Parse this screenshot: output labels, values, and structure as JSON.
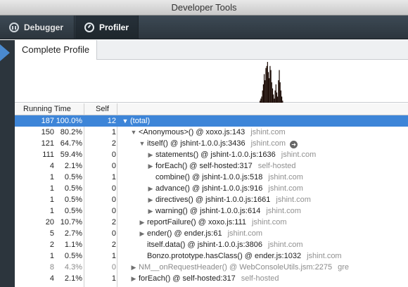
{
  "window": {
    "title": "Developer Tools"
  },
  "tabs": [
    {
      "label": "Debugger",
      "active": false
    },
    {
      "label": "Profiler",
      "active": true
    }
  ],
  "profile": {
    "tab_label": "Complete Profile"
  },
  "columns": {
    "running_time": "Running Time",
    "self": "Self"
  },
  "colors": {
    "selected_row": "#3d85d8",
    "toolbar": "#2f3a43"
  },
  "graph_values": [
    0,
    0,
    0,
    0,
    0,
    0,
    0,
    0,
    0,
    0,
    0,
    0,
    0,
    0,
    0,
    0,
    0,
    0,
    0,
    0,
    0,
    0,
    0,
    0,
    0,
    0,
    0,
    0,
    0,
    0,
    0,
    0,
    0,
    0,
    0,
    0,
    0,
    0,
    0,
    0,
    0,
    0,
    0,
    0,
    0,
    0,
    0,
    0,
    0,
    0,
    0,
    0,
    0,
    0,
    0,
    0,
    0,
    0,
    0,
    0,
    0,
    0,
    0,
    0,
    0,
    0,
    0,
    0,
    0,
    0,
    0,
    0,
    0,
    0,
    0,
    0,
    0,
    0,
    0,
    0,
    0,
    0,
    0,
    0,
    0,
    0,
    0,
    0,
    0,
    0,
    0,
    0,
    0,
    0,
    0,
    0,
    0,
    0,
    0,
    0,
    0,
    0,
    0,
    0,
    0,
    0,
    0,
    0,
    0,
    0,
    0,
    0,
    0,
    0,
    0,
    0,
    0,
    0,
    0,
    0,
    0,
    0,
    0,
    0,
    0,
    0,
    0,
    0,
    0,
    0,
    0,
    0,
    0,
    0,
    0,
    0,
    0,
    0,
    0,
    0,
    0,
    0,
    0,
    0,
    0,
    0,
    0,
    0,
    0,
    0,
    0,
    0,
    0,
    0,
    0,
    0,
    0,
    0,
    0,
    0,
    0,
    0,
    0,
    0,
    0,
    0,
    0,
    0,
    0,
    0,
    0,
    0,
    0,
    0,
    0,
    0,
    0,
    0,
    0,
    0,
    0,
    0,
    0,
    0,
    0,
    0,
    0,
    0,
    0,
    0,
    0,
    0,
    0,
    0,
    0,
    0,
    0,
    0,
    0,
    0,
    0,
    0,
    0,
    0,
    0,
    0,
    0,
    0,
    0,
    0,
    0,
    0,
    0,
    0,
    0,
    0,
    0,
    0,
    0,
    0,
    0,
    0,
    0,
    0,
    0,
    0,
    0,
    0,
    0,
    0,
    0,
    0,
    0,
    0,
    0,
    0,
    0,
    0,
    0,
    0,
    0,
    0,
    0,
    0,
    0,
    0,
    0,
    0,
    0,
    0,
    0,
    0,
    0,
    0,
    0,
    0,
    0,
    0,
    0,
    0,
    0,
    0,
    0,
    0,
    0,
    0,
    0,
    0,
    0,
    0,
    0,
    0,
    0,
    0,
    0,
    0,
    0,
    0,
    0,
    0,
    0,
    0,
    0,
    0,
    0,
    0,
    0,
    0,
    0,
    0,
    0,
    0,
    0.05,
    0.1,
    0.15,
    0.3,
    0.45,
    0.7,
    0.55,
    0.85,
    0.9,
    1,
    0.75,
    0.6,
    0.9,
    0.8,
    0.5,
    0.35,
    0.2,
    0.1,
    0.3,
    0.45,
    0.25,
    0.15,
    0.55,
    0.8,
    0.5,
    0.3,
    0.15,
    0.05,
    0,
    0,
    0,
    0,
    0,
    0,
    0,
    0,
    0,
    0,
    0,
    0,
    0,
    0,
    0,
    0,
    0,
    0,
    0,
    0,
    0,
    0,
    0,
    0,
    0,
    0,
    0,
    0,
    0,
    0,
    0,
    0,
    0,
    0,
    0,
    0,
    0,
    0,
    0,
    0,
    0,
    0,
    0,
    0,
    0,
    0,
    0,
    0,
    0,
    0,
    0,
    0,
    0,
    0,
    0,
    0,
    0,
    0,
    0,
    0,
    0,
    0,
    0,
    0,
    0,
    0,
    0,
    0,
    0,
    0,
    0,
    0,
    0,
    0,
    0,
    0,
    0,
    0,
    0,
    0,
    0,
    0,
    0,
    0,
    0,
    0,
    0,
    0,
    0,
    0,
    0,
    0,
    0,
    0,
    0,
    0,
    0,
    0,
    0,
    0,
    0,
    0,
    0,
    0,
    0,
    0,
    0,
    0,
    0,
    0,
    0,
    0,
    0,
    0,
    0,
    0,
    0,
    0,
    0,
    0,
    0,
    0,
    0,
    0,
    0,
    0,
    0,
    0,
    0,
    0,
    0,
    0,
    0,
    0,
    0,
    0,
    0,
    0,
    0,
    0,
    0,
    0,
    0,
    0,
    0,
    0,
    0,
    0,
    0
  ],
  "rows": [
    {
      "ms": "187",
      "pct": "100.0%",
      "self": "12",
      "depth": 0,
      "twisty": "open",
      "fn": "(total)",
      "host": "",
      "go": false,
      "selected": true
    },
    {
      "ms": "150",
      "pct": "80.2%",
      "self": "1",
      "depth": 1,
      "twisty": "open",
      "fn": "<Anonymous>() @ xoxo.js:143",
      "host": "jshint.com",
      "go": false
    },
    {
      "ms": "121",
      "pct": "64.7%",
      "self": "2",
      "depth": 2,
      "twisty": "open",
      "fn": "itself() @ jshint-1.0.0.js:3436",
      "host": "jshint.com",
      "go": true
    },
    {
      "ms": "111",
      "pct": "59.4%",
      "self": "0",
      "depth": 3,
      "twisty": "closed",
      "fn": "statements() @ jshint-1.0.0.js:1636",
      "host": "jshint.com",
      "go": false
    },
    {
      "ms": "4",
      "pct": "2.1%",
      "self": "0",
      "depth": 3,
      "twisty": "closed",
      "fn": "forEach() @ self-hosted:317",
      "host": "self-hosted",
      "go": false
    },
    {
      "ms": "1",
      "pct": "0.5%",
      "self": "1",
      "depth": 3,
      "twisty": "none",
      "fn": "combine() @ jshint-1.0.0.js:518",
      "host": "jshint.com",
      "go": false
    },
    {
      "ms": "1",
      "pct": "0.5%",
      "self": "0",
      "depth": 3,
      "twisty": "closed",
      "fn": "advance() @ jshint-1.0.0.js:916",
      "host": "jshint.com",
      "go": false
    },
    {
      "ms": "1",
      "pct": "0.5%",
      "self": "0",
      "depth": 3,
      "twisty": "closed",
      "fn": "directives() @ jshint-1.0.0.js:1661",
      "host": "jshint.com",
      "go": false
    },
    {
      "ms": "1",
      "pct": "0.5%",
      "self": "0",
      "depth": 3,
      "twisty": "closed",
      "fn": "warning() @ jshint-1.0.0.js:614",
      "host": "jshint.com",
      "go": false
    },
    {
      "ms": "20",
      "pct": "10.7%",
      "self": "2",
      "depth": 2,
      "twisty": "closed",
      "fn": "reportFailure() @ xoxo.js:111",
      "host": "jshint.com",
      "go": false
    },
    {
      "ms": "5",
      "pct": "2.7%",
      "self": "0",
      "depth": 2,
      "twisty": "closed",
      "fn": "ender() @ ender.js:61",
      "host": "jshint.com",
      "go": false
    },
    {
      "ms": "2",
      "pct": "1.1%",
      "self": "2",
      "depth": 2,
      "twisty": "none",
      "fn": "itself.data() @ jshint-1.0.0.js:3806",
      "host": "jshint.com",
      "go": false
    },
    {
      "ms": "1",
      "pct": "0.5%",
      "self": "1",
      "depth": 2,
      "twisty": "none",
      "fn": "Bonzo.prototype.hasClass() @ ender.js:1032",
      "host": "jshint.com",
      "go": false
    },
    {
      "ms": "8",
      "pct": "4.3%",
      "self": "0",
      "depth": 1,
      "twisty": "closed",
      "fn": "NM__onRequestHeader() @ WebConsoleUtils.jsm:2275",
      "host": "gre",
      "go": false,
      "dim": true
    },
    {
      "ms": "4",
      "pct": "2.1%",
      "self": "1",
      "depth": 1,
      "twisty": "closed",
      "fn": "forEach() @ self-hosted:317",
      "host": "self-hosted",
      "go": false
    }
  ]
}
